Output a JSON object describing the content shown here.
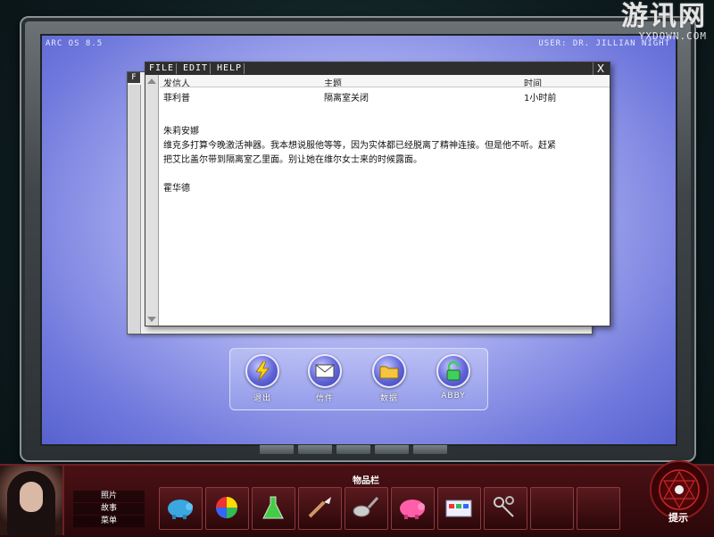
{
  "os": {
    "name": "ARC OS 8.5",
    "user": "USER: DR. JILLIAN NIGHT"
  },
  "watermark": {
    "main": "游讯网",
    "sub": "YXDOWN.COM"
  },
  "mail_window": {
    "menu": [
      "FILE",
      "EDIT",
      "HELP"
    ],
    "close": "X",
    "columns": {
      "sender": "发信人",
      "subject": "主题",
      "time": "时间"
    },
    "message": {
      "sender": "菲利普",
      "subject": "隔离室关闭",
      "time": "1小时前"
    },
    "body": {
      "greeting": "朱莉安娜",
      "line1": "维克多打算今晚激活神器。我本想说服他等等，因为实体都已经脱离了精神连接。但是他不听。赶紧",
      "line2": "把艾比盖尔带到隔离室乙里面。别让她在维尔女士来的时候露面。",
      "signature": "霍华德"
    },
    "back_title": "F"
  },
  "dock": [
    {
      "label": "退出",
      "icon": "lightning-icon"
    },
    {
      "label": "信件",
      "icon": "envelope-icon"
    },
    {
      "label": "数据",
      "icon": "folder-icon"
    },
    {
      "label": "ABBY",
      "icon": "padlock-icon"
    }
  ],
  "side_menu": [
    "照片",
    "故事",
    "菜单"
  ],
  "inventory": {
    "title": "物品栏",
    "items": [
      "piggy-bank-blue-icon",
      "color-wheel-icon",
      "flask-icon",
      "paintbrush-icon",
      "magnifier-spoon-icon",
      "piggy-bank-pink-icon",
      "paint-set-icon",
      "keys-icon",
      "empty",
      "empty"
    ]
  },
  "hint": {
    "label": "提示"
  }
}
